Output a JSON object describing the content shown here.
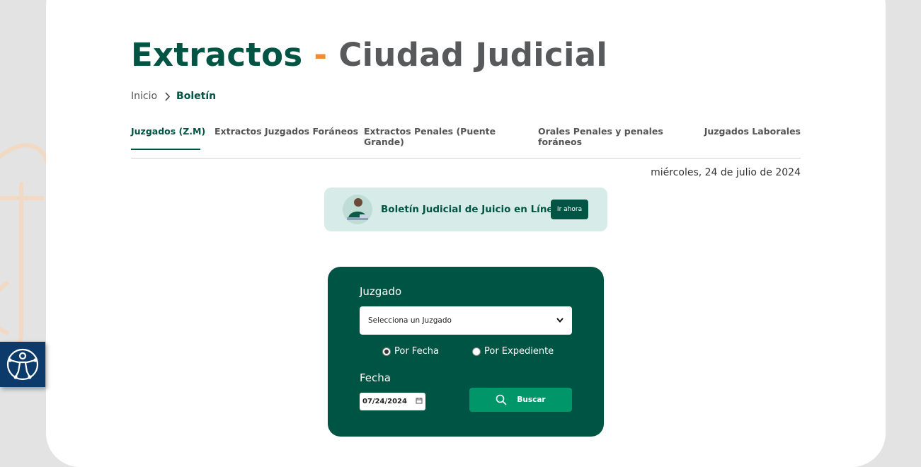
{
  "header": {
    "title_main": "Extractos",
    "title_separator": "-",
    "title_secondary": "Ciudad Judicial"
  },
  "breadcrumb": {
    "home": "Inicio",
    "current": "Boletín"
  },
  "tabs": [
    {
      "label": "Juzgados (Z.M)",
      "active": true
    },
    {
      "label": "Extractos Juzgados Foráneos",
      "active": false
    },
    {
      "label": "Extractos Penales (Puente Grande)",
      "active": false
    },
    {
      "label": "Orales Penales y penales foráneos",
      "active": false
    },
    {
      "label": "Juzgados Laborales",
      "active": false
    }
  ],
  "date_text": "miércoles, 24 de julio de 2024",
  "banner": {
    "text": "Boletín Judicial de Juicio en Línea",
    "button": "Ir ahora"
  },
  "search": {
    "juzgado_label": "Juzgado",
    "juzgado_selected": "Selecciona un Juzgado",
    "radio_fecha": "Por Fecha",
    "radio_expediente": "Por Expediente",
    "radio_selected": "Por Fecha",
    "fecha_label": "Fecha",
    "fecha_value": "07/24/2024",
    "buscar_button": "Buscar"
  },
  "colors": {
    "primary": "#005443",
    "accent": "#f28a2e",
    "secondary_text": "#58595b",
    "button_green": "#00966a",
    "banner_bg": "#d7ece8",
    "accessibility_bg": "#0c3b6b"
  },
  "icons": {
    "breadcrumb_separator": "chevron-right-icon",
    "select_arrow": "chevron-down-icon",
    "date_picker": "calendar-icon",
    "search": "search-icon",
    "accessibility": "accessibility-icon"
  }
}
